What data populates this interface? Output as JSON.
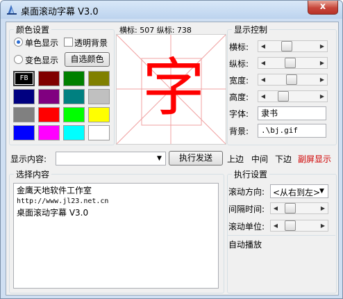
{
  "window": {
    "title": "桌面滚动字幕 V3.0",
    "close_glyph": "x"
  },
  "color_settings": {
    "legend": "颜色设置",
    "single_color_label": "单色显示",
    "transparent_bg_label": "透明背景",
    "gradient_color_label": "变色显示",
    "custom_color_button": "自选颜色",
    "palette": [
      "#000000",
      "#800000",
      "#008000",
      "#808000",
      "#000080",
      "#800080",
      "#008080",
      "#c0c0c0",
      "#808080",
      "#ff0000",
      "#00ff00",
      "#ffff00",
      "#0000ff",
      "#ff00ff",
      "#00ffff",
      "#ffffff"
    ],
    "selected_swatch_text": "FB"
  },
  "preview": {
    "coords_text": "横标: 507 纵标: 738",
    "character": "字",
    "character_color": "#ff0000",
    "guide_color": "#f0a0a0"
  },
  "display_control": {
    "legend": "显示控制",
    "sliders": [
      {
        "label": "横标:",
        "value_fraction": 0.35
      },
      {
        "label": "纵标:",
        "value_fraction": 0.43
      },
      {
        "label": "宽度:",
        "value_fraction": 0.48
      },
      {
        "label": "高度:",
        "value_fraction": 0.25
      }
    ],
    "font_label": "字体:",
    "font_value": "隶书",
    "background_label": "背景:",
    "background_value": ".\\bj.gif"
  },
  "content_row": {
    "label": "显示内容:",
    "input_value": "",
    "send_button": "执行发送",
    "positions": [
      {
        "label": "上边",
        "color": "#000000"
      },
      {
        "label": "中间",
        "color": "#000000"
      },
      {
        "label": "下边",
        "color": "#000000"
      },
      {
        "label": "副屏显示",
        "color": "#d00000"
      }
    ]
  },
  "select_content": {
    "legend": "选择内容",
    "lines": [
      "金鹰天地软件工作室",
      "http://www.jl23.net.cn",
      "桌面滚动字幕 V3.0"
    ]
  },
  "execute_settings": {
    "legend": "执行设置",
    "scroll_direction_label": "滚动方向:",
    "scroll_direction_value": "<从右到左>",
    "interval_label": "间隔时间:",
    "interval_fraction": 0.15,
    "unit_label": "滚动单位:",
    "unit_fraction": 0.15,
    "autoplay_label": "自动播放"
  }
}
